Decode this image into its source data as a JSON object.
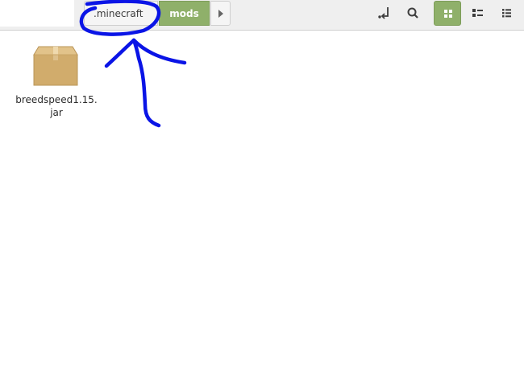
{
  "pathbar": {
    "crumbs": [
      {
        "label": ".minecraft"
      },
      {
        "label": "mods",
        "active": true
      }
    ]
  },
  "toolbar": {
    "icons": [
      "location-toggle-icon",
      "search-icon",
      "grid-view-icon",
      "list-view-icon",
      "compact-view-icon"
    ],
    "active_view": "grid"
  },
  "files": [
    {
      "name_line1": "breedspeed1.15.",
      "name_line2": "jar",
      "icon": "package-icon"
    }
  ],
  "colors": {
    "accent": "#8fb06a",
    "annotation": "#0a14e6",
    "package": "#d1ac6c"
  }
}
